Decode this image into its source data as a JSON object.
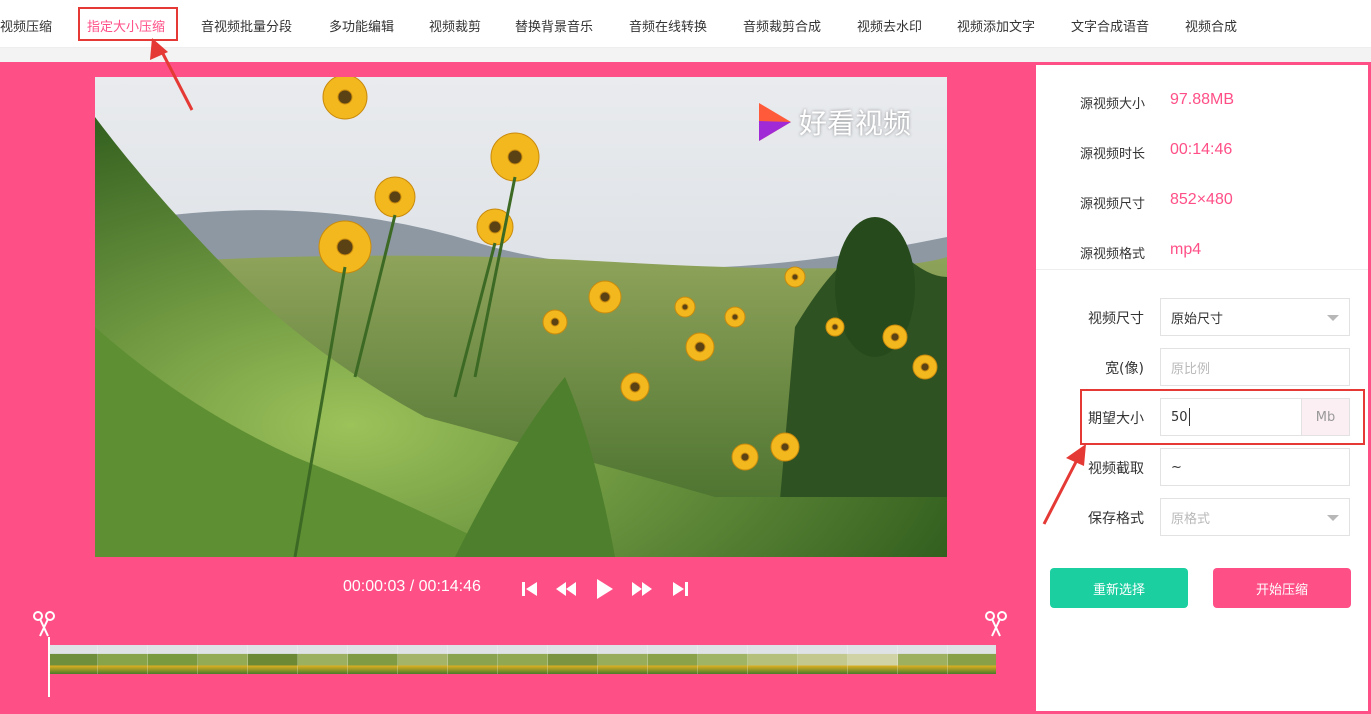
{
  "nav": {
    "tabs": [
      {
        "label": "视频压缩"
      },
      {
        "label": "指定大小压缩",
        "active": true
      },
      {
        "label": "音视频批量分段"
      },
      {
        "label": "多功能编辑"
      },
      {
        "label": "视频裁剪"
      },
      {
        "label": "替换背景音乐"
      },
      {
        "label": "音频在线转换"
      },
      {
        "label": "音频裁剪合成"
      },
      {
        "label": "视频去水印"
      },
      {
        "label": "视频添加文字"
      },
      {
        "label": "文字合成语音"
      },
      {
        "label": "视频合成"
      }
    ]
  },
  "video": {
    "watermark_text": "好看视频",
    "current_time": "00:00:03",
    "separator": "/",
    "total_time": "00:14:46"
  },
  "info": {
    "size_label": "源视频大小",
    "size_value": "97.88MB",
    "duration_label": "源视频时长",
    "duration_value": "00:14:46",
    "dimensions_label": "源视频尺寸",
    "dimensions_value": "852×480",
    "format_label": "源视频格式",
    "format_value": "mp4"
  },
  "form": {
    "video_size_label": "视频尺寸",
    "video_size_value": "原始尺寸",
    "width_label": "宽(像)",
    "width_placeholder": "原比例",
    "target_size_label": "期望大小",
    "target_size_value": "50",
    "target_size_unit": "Mb",
    "clip_label": "视频截取",
    "clip_value": "~",
    "save_format_label": "保存格式",
    "save_format_value": "原格式"
  },
  "buttons": {
    "reselect": "重新选择",
    "start": "开始压缩"
  },
  "colors": {
    "accent": "#ff4f87",
    "teal": "#1bcfa0",
    "highlight_red": "#e53935"
  },
  "icons": {
    "skip_start": "skip-to-start-icon",
    "rewind": "rewind-icon",
    "play": "play-icon",
    "fast_forward": "fast-forward-icon",
    "skip_end": "skip-to-end-icon",
    "scissor": "scissors-icon",
    "logo": "play-logo-icon"
  }
}
